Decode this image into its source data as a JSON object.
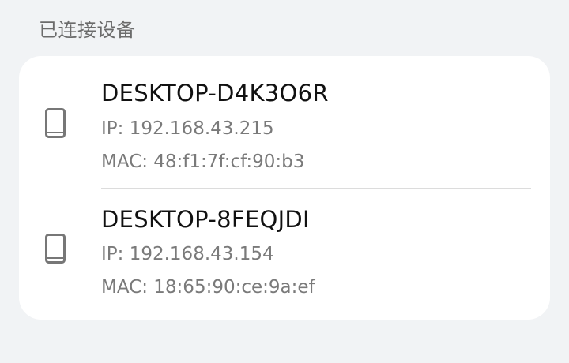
{
  "section_title": "已连接设备",
  "devices": [
    {
      "name": "DESKTOP-D4K3O6R",
      "ip": "IP: 192.168.43.215",
      "mac": "MAC: 48:f1:7f:cf:90:b3",
      "icon": "phone-icon"
    },
    {
      "name": "DESKTOP-8FEQJDI",
      "ip": "IP: 192.168.43.154",
      "mac": "MAC: 18:65:90:ce:9a:ef",
      "icon": "phone-icon"
    }
  ],
  "colors": {
    "background": "#f1f3f5",
    "card": "#ffffff",
    "title_text": "#111111",
    "secondary_text": "#7a7a7a",
    "icon": "#777777"
  }
}
